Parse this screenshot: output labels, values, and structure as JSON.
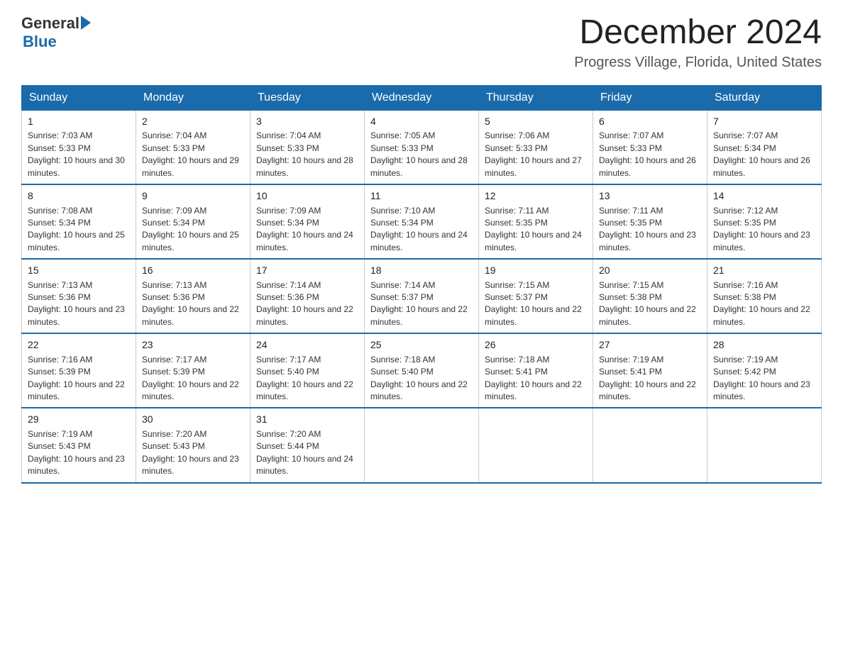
{
  "logo": {
    "general": "General",
    "blue": "Blue"
  },
  "title": "December 2024",
  "subtitle": "Progress Village, Florida, United States",
  "days_of_week": [
    "Sunday",
    "Monday",
    "Tuesday",
    "Wednesday",
    "Thursday",
    "Friday",
    "Saturday"
  ],
  "weeks": [
    [
      {
        "day": "1",
        "sunrise": "7:03 AM",
        "sunset": "5:33 PM",
        "daylight": "10 hours and 30 minutes."
      },
      {
        "day": "2",
        "sunrise": "7:04 AM",
        "sunset": "5:33 PM",
        "daylight": "10 hours and 29 minutes."
      },
      {
        "day": "3",
        "sunrise": "7:04 AM",
        "sunset": "5:33 PM",
        "daylight": "10 hours and 28 minutes."
      },
      {
        "day": "4",
        "sunrise": "7:05 AM",
        "sunset": "5:33 PM",
        "daylight": "10 hours and 28 minutes."
      },
      {
        "day": "5",
        "sunrise": "7:06 AM",
        "sunset": "5:33 PM",
        "daylight": "10 hours and 27 minutes."
      },
      {
        "day": "6",
        "sunrise": "7:07 AM",
        "sunset": "5:33 PM",
        "daylight": "10 hours and 26 minutes."
      },
      {
        "day": "7",
        "sunrise": "7:07 AM",
        "sunset": "5:34 PM",
        "daylight": "10 hours and 26 minutes."
      }
    ],
    [
      {
        "day": "8",
        "sunrise": "7:08 AM",
        "sunset": "5:34 PM",
        "daylight": "10 hours and 25 minutes."
      },
      {
        "day": "9",
        "sunrise": "7:09 AM",
        "sunset": "5:34 PM",
        "daylight": "10 hours and 25 minutes."
      },
      {
        "day": "10",
        "sunrise": "7:09 AM",
        "sunset": "5:34 PM",
        "daylight": "10 hours and 24 minutes."
      },
      {
        "day": "11",
        "sunrise": "7:10 AM",
        "sunset": "5:34 PM",
        "daylight": "10 hours and 24 minutes."
      },
      {
        "day": "12",
        "sunrise": "7:11 AM",
        "sunset": "5:35 PM",
        "daylight": "10 hours and 24 minutes."
      },
      {
        "day": "13",
        "sunrise": "7:11 AM",
        "sunset": "5:35 PM",
        "daylight": "10 hours and 23 minutes."
      },
      {
        "day": "14",
        "sunrise": "7:12 AM",
        "sunset": "5:35 PM",
        "daylight": "10 hours and 23 minutes."
      }
    ],
    [
      {
        "day": "15",
        "sunrise": "7:13 AM",
        "sunset": "5:36 PM",
        "daylight": "10 hours and 23 minutes."
      },
      {
        "day": "16",
        "sunrise": "7:13 AM",
        "sunset": "5:36 PM",
        "daylight": "10 hours and 22 minutes."
      },
      {
        "day": "17",
        "sunrise": "7:14 AM",
        "sunset": "5:36 PM",
        "daylight": "10 hours and 22 minutes."
      },
      {
        "day": "18",
        "sunrise": "7:14 AM",
        "sunset": "5:37 PM",
        "daylight": "10 hours and 22 minutes."
      },
      {
        "day": "19",
        "sunrise": "7:15 AM",
        "sunset": "5:37 PM",
        "daylight": "10 hours and 22 minutes."
      },
      {
        "day": "20",
        "sunrise": "7:15 AM",
        "sunset": "5:38 PM",
        "daylight": "10 hours and 22 minutes."
      },
      {
        "day": "21",
        "sunrise": "7:16 AM",
        "sunset": "5:38 PM",
        "daylight": "10 hours and 22 minutes."
      }
    ],
    [
      {
        "day": "22",
        "sunrise": "7:16 AM",
        "sunset": "5:39 PM",
        "daylight": "10 hours and 22 minutes."
      },
      {
        "day": "23",
        "sunrise": "7:17 AM",
        "sunset": "5:39 PM",
        "daylight": "10 hours and 22 minutes."
      },
      {
        "day": "24",
        "sunrise": "7:17 AM",
        "sunset": "5:40 PM",
        "daylight": "10 hours and 22 minutes."
      },
      {
        "day": "25",
        "sunrise": "7:18 AM",
        "sunset": "5:40 PM",
        "daylight": "10 hours and 22 minutes."
      },
      {
        "day": "26",
        "sunrise": "7:18 AM",
        "sunset": "5:41 PM",
        "daylight": "10 hours and 22 minutes."
      },
      {
        "day": "27",
        "sunrise": "7:19 AM",
        "sunset": "5:41 PM",
        "daylight": "10 hours and 22 minutes."
      },
      {
        "day": "28",
        "sunrise": "7:19 AM",
        "sunset": "5:42 PM",
        "daylight": "10 hours and 23 minutes."
      }
    ],
    [
      {
        "day": "29",
        "sunrise": "7:19 AM",
        "sunset": "5:43 PM",
        "daylight": "10 hours and 23 minutes."
      },
      {
        "day": "30",
        "sunrise": "7:20 AM",
        "sunset": "5:43 PM",
        "daylight": "10 hours and 23 minutes."
      },
      {
        "day": "31",
        "sunrise": "7:20 AM",
        "sunset": "5:44 PM",
        "daylight": "10 hours and 24 minutes."
      },
      null,
      null,
      null,
      null
    ]
  ]
}
